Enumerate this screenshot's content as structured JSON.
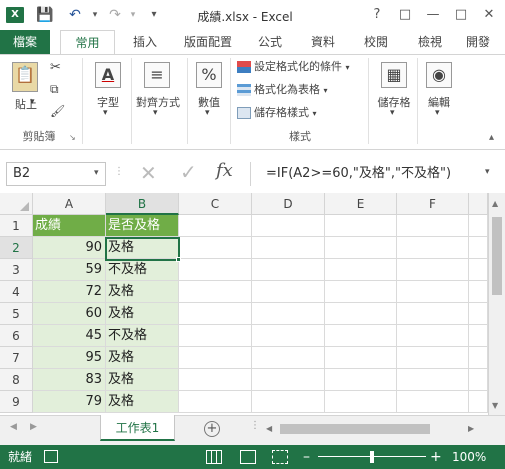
{
  "title": "成績.xlsx - Excel",
  "ribbon_tabs": [
    "檔案",
    "常用",
    "插入",
    "版面配置",
    "公式",
    "資料",
    "校閱",
    "檢視",
    "開發"
  ],
  "ribbon": {
    "paste": "貼上",
    "clipboard": "剪貼簿",
    "font": "字型",
    "alignment": "對齊方式",
    "number": "數值",
    "cond_format": "設定格式化的條件",
    "format_table": "格式化為表格",
    "cell_styles": "儲存格樣式",
    "styles": "樣式",
    "cells": "儲存格",
    "editing": "編輯"
  },
  "formula_bar": {
    "name_box": "B2",
    "formula": "=IF(A2>=60,\"及格\",\"不及格\")"
  },
  "columns": [
    "A",
    "B",
    "C",
    "D",
    "E",
    "F"
  ],
  "rows": [
    {
      "n": "1",
      "a": "成績",
      "b": "是否及格"
    },
    {
      "n": "2",
      "a": "90",
      "b": "及格"
    },
    {
      "n": "3",
      "a": "59",
      "b": "不及格"
    },
    {
      "n": "4",
      "a": "72",
      "b": "及格"
    },
    {
      "n": "5",
      "a": "60",
      "b": "及格"
    },
    {
      "n": "6",
      "a": "45",
      "b": "不及格"
    },
    {
      "n": "7",
      "a": "95",
      "b": "及格"
    },
    {
      "n": "8",
      "a": "83",
      "b": "及格"
    },
    {
      "n": "9",
      "a": "79",
      "b": "及格"
    }
  ],
  "sheet_tab": "工作表1",
  "status": {
    "mode": "就緒",
    "zoom": "100%"
  },
  "colors": {
    "accent": "#217346",
    "header_fill": "#70ad47",
    "data_fill": "#e2efda"
  }
}
